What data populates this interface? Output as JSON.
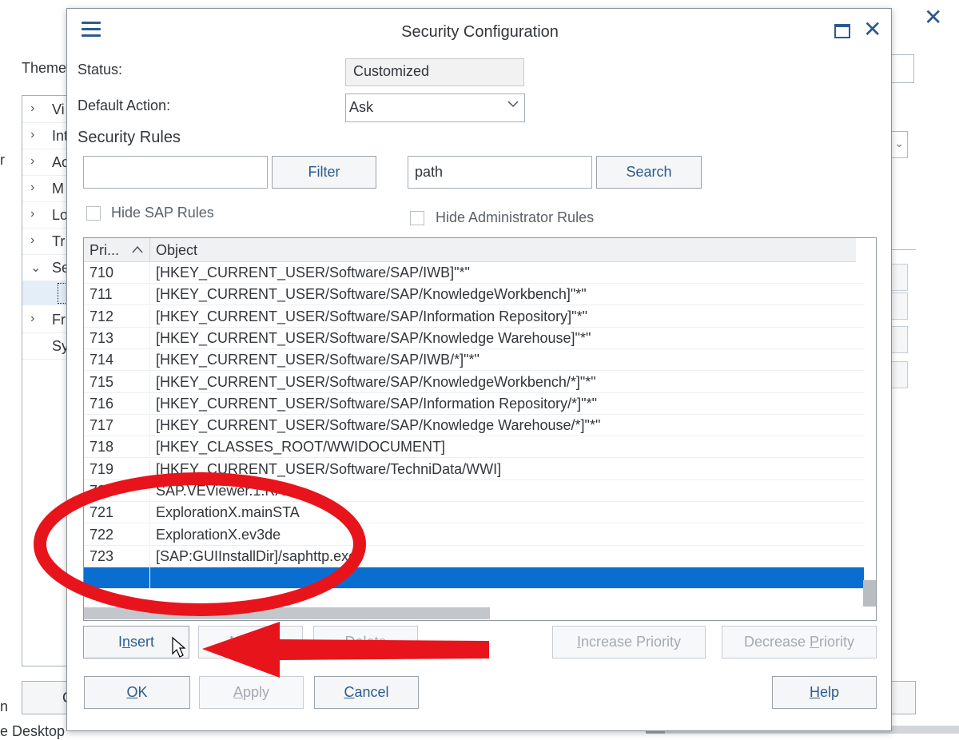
{
  "background": {
    "theme_label": "Theme",
    "left_edge_char": "r",
    "left_edge_char2": "n",
    "bottom_left_button_char": "C",
    "bottom_text": "e Desktop",
    "tree_items": [
      {
        "label": "Vi",
        "chevron": "›"
      },
      {
        "label": "Int",
        "chevron": "›"
      },
      {
        "label": "Ac",
        "chevron": "›"
      },
      {
        "label": "M",
        "chevron": "›"
      },
      {
        "label": "Lo",
        "chevron": "›"
      },
      {
        "label": "Tr",
        "chevron": "›"
      },
      {
        "label": "Se",
        "chevron": "⌄"
      },
      {
        "label": "",
        "chevron": ""
      },
      {
        "label": "Fr",
        "chevron": "›"
      },
      {
        "label": "Sy",
        "chevron": ""
      }
    ],
    "close_glyph": "✕"
  },
  "dialog": {
    "title": "Security Configuration",
    "close_glyph": "✕",
    "status_label": "Status:",
    "status_value": "Customized",
    "default_action_label": "Default Action:",
    "default_action_value": "Ask",
    "section_title": "Security Rules",
    "filter_input_value": "",
    "filter_button": "Filter",
    "search_input_value": "path",
    "search_button": "Search",
    "hide_sap_rules_label": "Hide SAP Rules",
    "hide_sap_rules_checked": false,
    "hide_admin_rules_label": "Hide Administrator Rules",
    "hide_admin_rules_checked": false,
    "table": {
      "columns": [
        "Pri...",
        "Object"
      ],
      "sort_column": "Pri...",
      "sort_direction": "ascending",
      "rows": [
        {
          "priority": "710",
          "object": "[HKEY_CURRENT_USER/Software/SAP/IWB]\"*\""
        },
        {
          "priority": "711",
          "object": "[HKEY_CURRENT_USER/Software/SAP/KnowledgeWorkbench]\"*\""
        },
        {
          "priority": "712",
          "object": "[HKEY_CURRENT_USER/Software/SAP/Information Repository]\"*\""
        },
        {
          "priority": "713",
          "object": "[HKEY_CURRENT_USER/Software/SAP/Knowledge Warehouse]\"*\""
        },
        {
          "priority": "714",
          "object": "[HKEY_CURRENT_USER/Software/SAP/IWB/*]\"*\""
        },
        {
          "priority": "715",
          "object": "[HKEY_CURRENT_USER/Software/SAP/KnowledgeWorkbench/*]\"*\""
        },
        {
          "priority": "716",
          "object": "[HKEY_CURRENT_USER/Software/SAP/Information Repository/*]\"*\""
        },
        {
          "priority": "717",
          "object": "[HKEY_CURRENT_USER/Software/SAP/Knowledge Warehouse/*]\"*\""
        },
        {
          "priority": "718",
          "object": "[HKEY_CLASSES_ROOT/WWIDOCUMENT]"
        },
        {
          "priority": "719",
          "object": "[HKEY_CURRENT_USER/Software/TechniData/WWI]"
        },
        {
          "priority": "720",
          "object": "SAP.VEViewer.1.RAP"
        },
        {
          "priority": "721",
          "object": "ExplorationX.mainSTA"
        },
        {
          "priority": "722",
          "object": "ExplorationX.ev3de"
        },
        {
          "priority": "723",
          "object": "[SAP:GUIInstallDir]/saphttp.exe"
        },
        {
          "priority": "",
          "object": ""
        }
      ],
      "selected_row_index": 14
    },
    "buttons": {
      "insert": "Insert",
      "insert_mnemonic_pre": "I",
      "insert_mnemonic": "n",
      "insert_mnemonic_post": "sert",
      "modify": "Modify",
      "delete": "Delete",
      "increase_priority_pre": "",
      "increase_priority_mnemonic": "I",
      "increase_priority_post": "ncrease Priority",
      "decrease_priority_pre": "Decrease ",
      "decrease_priority_mnemonic": "P",
      "decrease_priority_post": "riority",
      "ok_mnemonic": "O",
      "ok_post": "K",
      "apply_mnemonic": "A",
      "apply_post": "pply",
      "cancel_mnemonic": "C",
      "cancel_post": "ancel",
      "help_mnemonic": "H",
      "help_post": "elp"
    }
  },
  "annotations": {
    "ellipse_color": "#e8141c",
    "arrow_color": "#e8141c"
  },
  "colors": {
    "accent": "#2c5b8f",
    "selection": "#0a6ed1",
    "annotation": "#e8141c"
  }
}
